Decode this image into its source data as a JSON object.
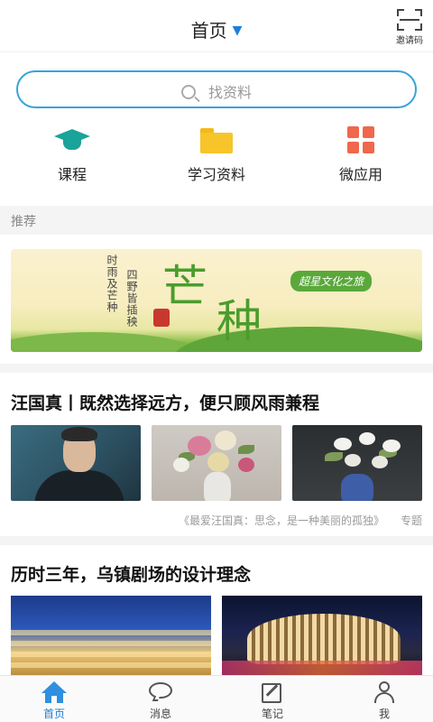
{
  "header": {
    "title": "首页",
    "invite_label": "邀请码"
  },
  "search": {
    "placeholder": "找资料"
  },
  "quick_links": [
    {
      "label": "课程",
      "icon": "graduation-cap-icon",
      "color": "#1aa39a"
    },
    {
      "label": "学习资料",
      "icon": "folder-icon",
      "color": "#f7c52a"
    },
    {
      "label": "微应用",
      "icon": "apps-grid-icon",
      "color": "#f0674b"
    }
  ],
  "section": {
    "title": "推荐"
  },
  "banner": {
    "line1": "时雨及芒种",
    "line2": "四野皆插秧",
    "big_char_1": "芒",
    "big_char_2": "种",
    "tag": "超星文化之旅"
  },
  "articles": [
    {
      "title": "汪国真丨既然选择远方，便只顾风雨兼程",
      "caption": "《最爱汪国真：思念，是一种美丽的孤独》",
      "topic": "专题"
    },
    {
      "title": "历时三年，乌镇剧场的设计理念"
    }
  ],
  "tabbar": [
    {
      "label": "首页",
      "icon": "home-icon",
      "active": true
    },
    {
      "label": "消息",
      "icon": "message-icon",
      "active": false
    },
    {
      "label": "笔记",
      "icon": "note-icon",
      "active": false
    },
    {
      "label": "我",
      "icon": "profile-icon",
      "active": false
    }
  ],
  "colors": {
    "accent": "#1f7fd8",
    "search_border": "#3aa3d9",
    "banner_green": "#4b9c2d"
  }
}
